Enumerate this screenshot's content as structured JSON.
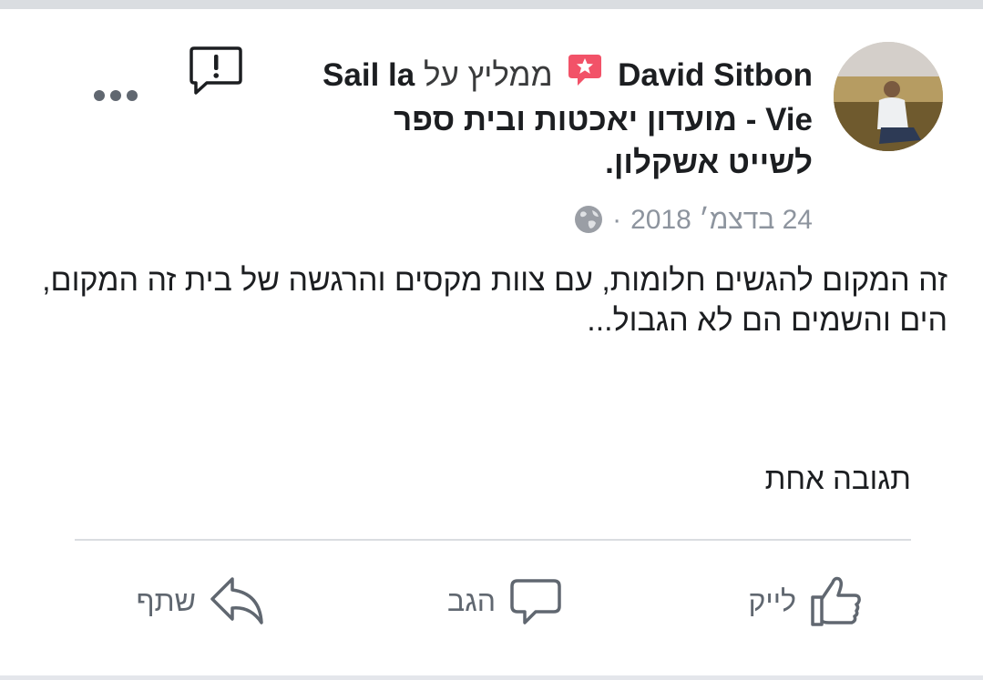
{
  "post": {
    "author_name": "David Sitbon",
    "recommends_verb": "ממליץ על",
    "page_name": "Sail la Vie - מועדון יאכטות ובית ספר לשייט אשקלון.",
    "date": "24 בדצמ׳ 2018",
    "separator": "·",
    "privacy_icon": "globe-icon",
    "body": "זה המקום להגשים חלומות, עם צוות מקסים והרגשה של בית זה המקום, הים והשמים הם  לא הגבול...",
    "comments_count": "תגובה אחת"
  },
  "actions": {
    "like_label": "לייק",
    "comment_label": "הגב",
    "share_label": "שתף"
  },
  "colors": {
    "badge": "#f25268",
    "text": "#1c1e21",
    "secondary": "#8d949e",
    "action": "#606770",
    "divider": "#dadde1"
  }
}
